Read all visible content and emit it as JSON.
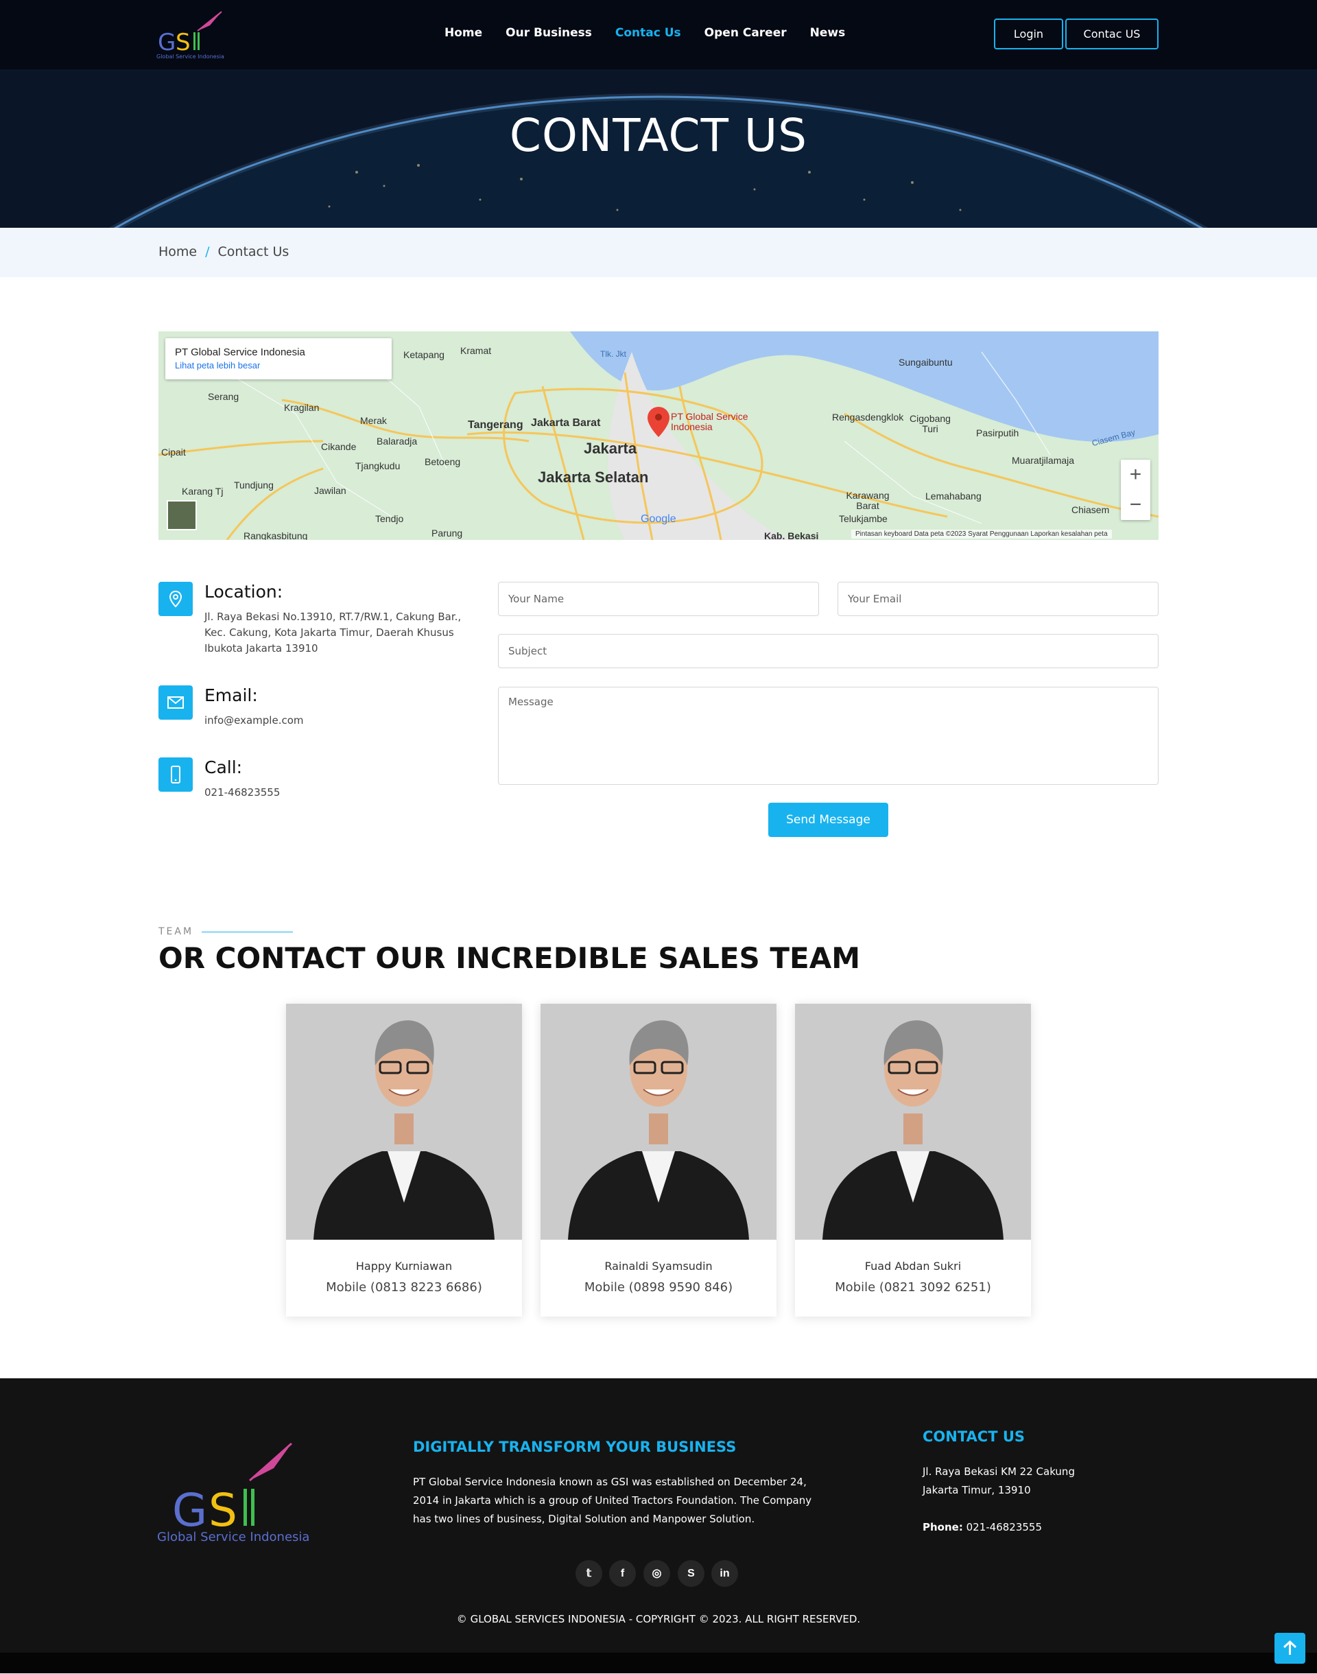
{
  "brand": {
    "logo_text": "GSI",
    "logo_sub": "Global Service Indonesia"
  },
  "nav": {
    "items": [
      "Home",
      "Our Business",
      "Contac Us",
      "Open Career",
      "News"
    ],
    "active": "Contac Us",
    "login_label": "Login",
    "contact_label": "Contac US"
  },
  "hero": {
    "title": "CONTACT US"
  },
  "breadcrumb": {
    "home": "Home",
    "sep": "/",
    "current": "Contact Us"
  },
  "map": {
    "place_title": "PT Global Service Indonesia",
    "place_link": "Lihat peta lebih besar",
    "pin_label": "PT Global Service Indonesia",
    "zoom_in": "+",
    "zoom_out": "−",
    "footer": "Pintasan keyboard   Data peta ©2023   Syarat Penggunaan   Laporkan kesalahan peta",
    "labels": [
      "Jakarta",
      "Jakarta Selatan",
      "Jakarta Barat",
      "Tangerang",
      "Serang",
      "Sungaibuntu",
      "Rengasdengklok",
      "Cigobang Turi",
      "Pasirputih",
      "Muaratjilamaja",
      "Karawang Barat",
      "Lemahabang",
      "Telukjambe",
      "Chiasem",
      "Cipait",
      "Karang Tj",
      "Tundjung",
      "Jawilan",
      "Cikande",
      "Balaradja",
      "Merak",
      "Kragilan",
      "Kramat",
      "Ketapang",
      "Tjangkudu",
      "Betoeng",
      "Rangkasbitung",
      "Tendjo",
      "Parung",
      "Kab. Bekasi",
      "Tlk. Jkt",
      "Ciasem Bay",
      "Google"
    ]
  },
  "contact": {
    "location_title": "Location:",
    "location_text": "Jl. Raya Bekasi No.13910, RT.7/RW.1, Cakung Bar., Kec. Cakung, Kota Jakarta Timur, Daerah Khusus Ibukota Jakarta 13910",
    "email_title": "Email:",
    "email_text": "info@example.com",
    "call_title": "Call:",
    "call_text": "021-46823555"
  },
  "form": {
    "name_placeholder": "Your Name",
    "email_placeholder": "Your Email",
    "subject_placeholder": "Subject",
    "message_placeholder": "Message",
    "send_label": "Send Message"
  },
  "team": {
    "tag": "TEAM",
    "title": "OR CONTACT OUR INCREDIBLE SALES TEAM",
    "members": [
      {
        "name": "Happy Kurniawan",
        "mobile": "Mobile (0813 8223 6686)"
      },
      {
        "name": "Rainaldi Syamsudin",
        "mobile": "Mobile (0898 9590 846)"
      },
      {
        "name": "Fuad Abdan Sukri",
        "mobile": "Mobile (0821 3092 6251)"
      }
    ]
  },
  "footer": {
    "about_title": "DIGITALLY TRANSFORM YOUR BUSINESS",
    "about_text": "PT Global Service Indonesia known as GSI was established on December 24, 2014 in Jakarta which is a group of United Tractors Foundation. The Company has two lines of business, Digital Solution and Manpower Solution.",
    "contact_title": "CONTACT US",
    "address_line1": "Jl. Raya Bekasi KM 22 Cakung",
    "address_line2": "Jakarta Timur, 13910",
    "phone_label": "Phone:",
    "phone_value": "021-46823555",
    "social": [
      "twitter-icon",
      "facebook-icon",
      "instagram-icon",
      "skype-icon",
      "linkedin-icon"
    ],
    "copyright": "© GLOBAL SERVICES INDONESIA - COPYRIGHT © 2023. ALL RIGHT RESERVED."
  },
  "colors": {
    "accent": "#18b3ef",
    "nav_bg": "#040914",
    "footer_bg": "#131313"
  }
}
